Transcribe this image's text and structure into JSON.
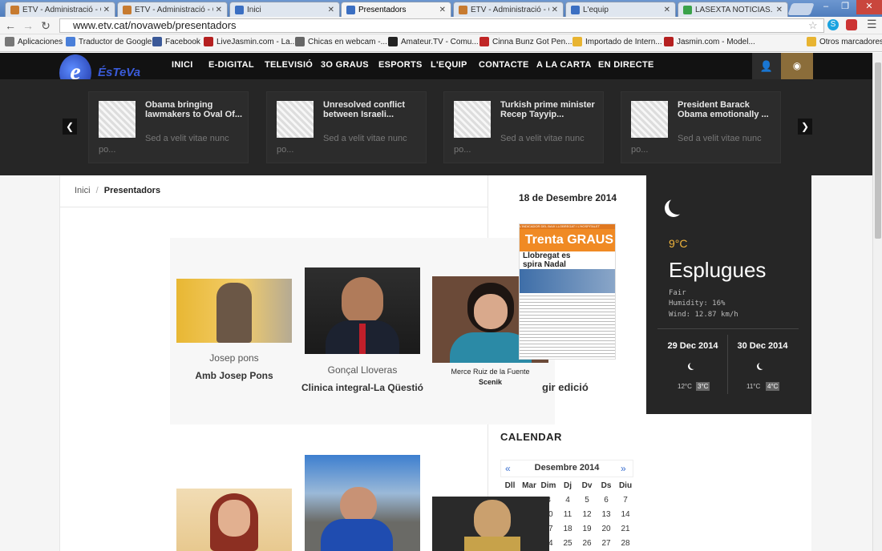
{
  "browser": {
    "tabs": [
      {
        "label": "ETV - Administració - Gr",
        "color": "#c77b30"
      },
      {
        "label": "ETV - Administració - Gr",
        "color": "#c77b30"
      },
      {
        "label": "Inici",
        "color": "#3b6fc2"
      },
      {
        "label": "Presentadors",
        "color": "#3b6fc2"
      },
      {
        "label": "ETV - Administració - Gr",
        "color": "#c77b30"
      },
      {
        "label": "L'equip",
        "color": "#3b6fc2"
      },
      {
        "label": "LASEXTA NOTICIAS. Últi",
        "color": "#3aa24a"
      }
    ],
    "url": "www.etv.cat/novaweb/presentadors",
    "bookmarks": [
      "Aplicaciones",
      "Traductor de Google",
      "Facebook",
      "LiveJasmin.com - La...",
      "Chicas en webcam -...",
      "Amateur.TV - Comu...",
      "Cinna Bunz Got Pen...",
      "Importado de Intern...",
      "Jasmin.com - Model...",
      "Otros marcadores"
    ]
  },
  "site": {
    "logo": "ÉsTeVa",
    "menu": [
      "INICI",
      "E-DIGITAL",
      "TELEVISIÓ",
      "3O GRAUS",
      "ESPORTS",
      "L'EQUIP",
      "CONTACTE",
      "A LA CARTA",
      "EN DIRECTE"
    ],
    "slider": [
      {
        "title": "Obama bringing lawmakers to Oval Of...",
        "sub": "Sed a velit vitae nunc",
        "sub2": "po..."
      },
      {
        "title": "Unresolved conflict between Israeli...",
        "sub": "Sed a velit vitae nunc",
        "sub2": "po..."
      },
      {
        "title": "Turkish prime minister Recep Tayyip...",
        "sub": "Sed a velit vitae nunc",
        "sub2": "po..."
      },
      {
        "title": "President Barack Obama emotionally ...",
        "sub": "Sed a velit vitae nunc",
        "sub2": "po..."
      }
    ],
    "breadcrumb": {
      "home": "Inici",
      "sep": "/",
      "current": "Presentadors"
    },
    "presenters": [
      {
        "name": "Josep pons",
        "show": "Amb Josep Pons"
      },
      {
        "name": "Gonçal Lloveras",
        "show": "Clinica integral-La Qüestió"
      },
      {
        "name": "Merce Ruiz de la Fuente",
        "show": "Scenik"
      }
    ],
    "edition": {
      "date": "18 de Desembre 2014",
      "cover_title": "Trenta GRAUS",
      "cover_top": "L'INDICADOR DEL BAIX LLOBREGAT I L'HOSPITALET",
      "cover_line1": "Llobregat es",
      "cover_line2": "spira Nadal",
      "link": "gir edició"
    },
    "weather": {
      "temp": "9°C",
      "city": "Esplugues",
      "cond": "Fair",
      "humidity": "Humidity: 16%",
      "wind": "Wind: 12.87 km/h",
      "forecast": [
        {
          "day": "29 Dec 2014",
          "lo": "12°C",
          "hi": "3°C"
        },
        {
          "day": "30 Dec 2014",
          "lo": "11°C",
          "hi": "4°C"
        }
      ]
    },
    "calendar": {
      "title": "CALENDAR",
      "prev": "«",
      "next": "»",
      "month": "Desembre 2014",
      "days": [
        "Dll",
        "Mar",
        "Dim",
        "Dj",
        "Dv",
        "Ds",
        "Diu"
      ],
      "rows": [
        [
          "",
          "",
          "3",
          "4",
          "5",
          "6",
          "7"
        ],
        [
          "",
          "",
          "10",
          "11",
          "12",
          "13",
          "14"
        ],
        [
          "",
          "",
          "17",
          "18",
          "19",
          "20",
          "21"
        ],
        [
          "",
          "",
          "24",
          "25",
          "26",
          "27",
          "28"
        ]
      ]
    }
  }
}
